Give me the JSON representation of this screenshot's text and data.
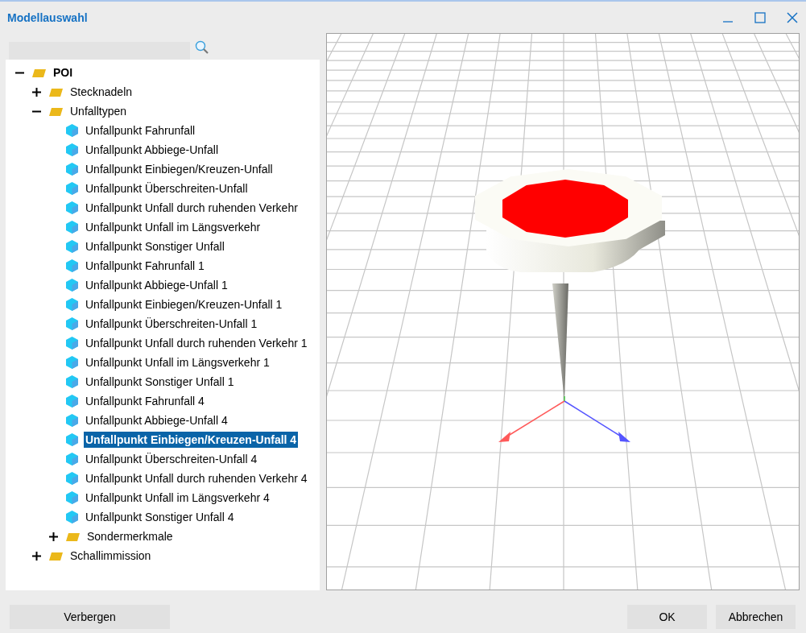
{
  "window": {
    "title": "Modellauswahl"
  },
  "tree": [
    {
      "label": "POI",
      "kind": "folder",
      "expanded": true,
      "selected": false,
      "bold": true,
      "children": [
        {
          "label": "Stecknadeln",
          "kind": "folder",
          "expanded": false,
          "selected": false
        },
        {
          "label": "Unfalltypen",
          "kind": "folder",
          "expanded": true,
          "selected": false,
          "children": [
            {
              "label": "Unfallpunkt Fahrunfall",
              "kind": "model",
              "selected": false
            },
            {
              "label": "Unfallpunkt Abbiege-Unfall",
              "kind": "model",
              "selected": false
            },
            {
              "label": "Unfallpunkt Einbiegen/Kreuzen-Unfall",
              "kind": "model",
              "selected": false
            },
            {
              "label": "Unfallpunkt Überschreiten-Unfall",
              "kind": "model",
              "selected": false
            },
            {
              "label": "Unfallpunkt Unfall durch ruhenden Verkehr",
              "kind": "model",
              "selected": false
            },
            {
              "label": "Unfallpunkt Unfall im Längsverkehr",
              "kind": "model",
              "selected": false
            },
            {
              "label": "Unfallpunkt Sonstiger Unfall",
              "kind": "model",
              "selected": false
            },
            {
              "label": "Unfallpunkt Fahrunfall 1",
              "kind": "model",
              "selected": false
            },
            {
              "label": "Unfallpunkt Abbiege-Unfall 1",
              "kind": "model",
              "selected": false
            },
            {
              "label": "Unfallpunkt Einbiegen/Kreuzen-Unfall 1",
              "kind": "model",
              "selected": false
            },
            {
              "label": "Unfallpunkt Überschreiten-Unfall 1",
              "kind": "model",
              "selected": false
            },
            {
              "label": "Unfallpunkt Unfall durch ruhenden Verkehr 1",
              "kind": "model",
              "selected": false
            },
            {
              "label": "Unfallpunkt Unfall im Längsverkehr 1",
              "kind": "model",
              "selected": false
            },
            {
              "label": "Unfallpunkt Sonstiger Unfall 1",
              "kind": "model",
              "selected": false
            },
            {
              "label": "Unfallpunkt Fahrunfall 4",
              "kind": "model",
              "selected": false
            },
            {
              "label": "Unfallpunkt Abbiege-Unfall 4",
              "kind": "model",
              "selected": false
            },
            {
              "label": "Unfallpunkt Einbiegen/Kreuzen-Unfall 4",
              "kind": "model",
              "selected": true
            },
            {
              "label": "Unfallpunkt Überschreiten-Unfall 4",
              "kind": "model",
              "selected": false
            },
            {
              "label": "Unfallpunkt Unfall durch ruhenden Verkehr 4",
              "kind": "model",
              "selected": false
            },
            {
              "label": "Unfallpunkt Unfall im Längsverkehr 4",
              "kind": "model",
              "selected": false
            },
            {
              "label": "Unfallpunkt Sonstiger Unfall 4",
              "kind": "model",
              "selected": false
            },
            {
              "label": "Sondermerkmale",
              "kind": "folder",
              "expanded": false,
              "selected": false
            }
          ]
        },
        {
          "label": "Schallimmission",
          "kind": "folder",
          "expanded": false,
          "selected": false
        }
      ]
    }
  ],
  "buttons": {
    "left": [
      "Verbergen"
    ],
    "right": [
      "OK",
      "Abbrechen"
    ]
  }
}
